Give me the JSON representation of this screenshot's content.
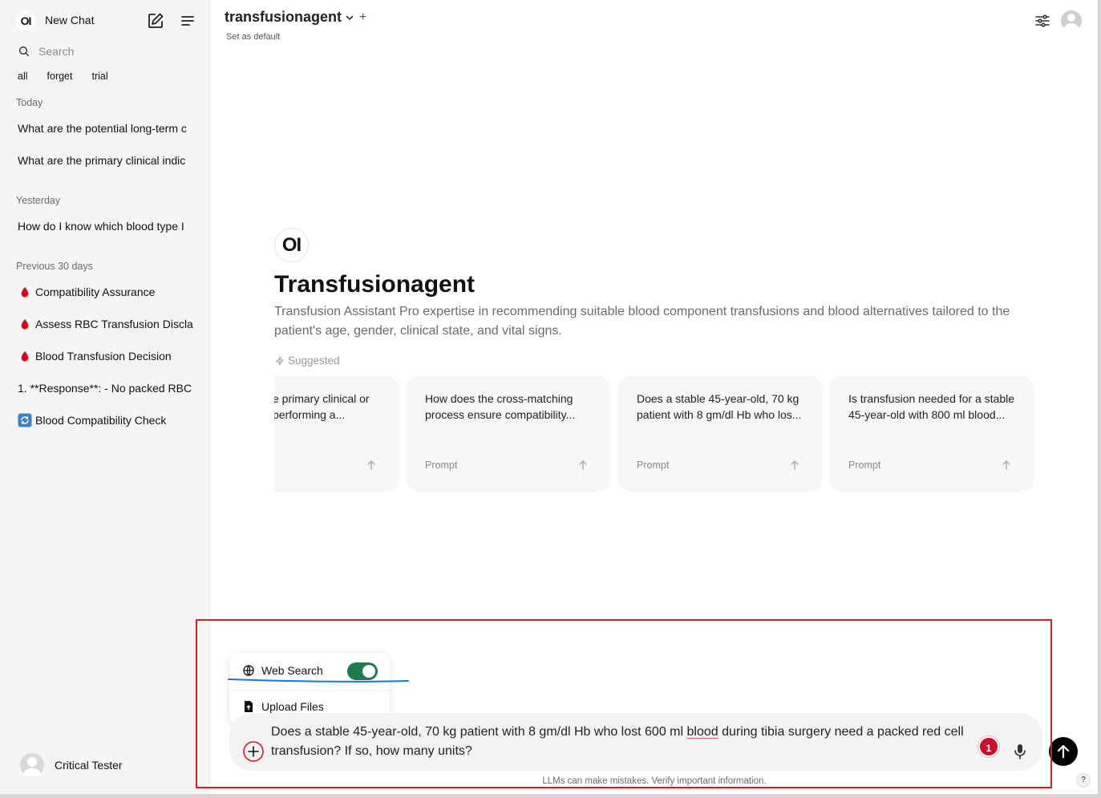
{
  "sidebar": {
    "logo_text": "OI",
    "new_chat_label": "New Chat",
    "search_placeholder": "Search",
    "tags": [
      "all",
      "forget",
      "trial"
    ],
    "sections": {
      "today": "Today",
      "yesterday": "Yesterday",
      "previous": "Previous 30 days"
    },
    "today_items": [
      "What are the potential long-term c",
      "What are the primary clinical indic"
    ],
    "yesterday_items": [
      "How do I know which blood type I"
    ],
    "previous_items": [
      {
        "label": "Compatibility Assurance",
        "icon": "blood-drop-icon"
      },
      {
        "label": "Assess RBC Transfusion Discla",
        "icon": "blood-drop-icon"
      },
      {
        "label": "Blood Transfusion Decision",
        "icon": "blood-drop-icon"
      },
      {
        "label": "1. **Response**: - No packed RBC",
        "icon": ""
      },
      {
        "label": "Blood Compatibility Check",
        "icon": "refresh-icon"
      }
    ],
    "user_name": "Critical Tester"
  },
  "header": {
    "model_name": "transfusionagent",
    "set_default": "Set as default"
  },
  "hero": {
    "logo_text": "OI",
    "title": "Transfusionagent",
    "description": "Transfusion Assistant Pro expertise in recommending suitable blood component transfusions and blood alternatives tailored to the patient's age, gender, clinical state, and vital signs.",
    "suggested_label": "Suggested"
  },
  "suggestions": [
    {
      "text": "e primary clinical or performing a...",
      "label": ""
    },
    {
      "text": "How does the cross-matching process ensure compatibility...",
      "label": "Prompt"
    },
    {
      "text": "Does a stable 45-year-old, 70 kg patient with 8 gm/dl Hb who los...",
      "label": "Prompt"
    },
    {
      "text": "Is transfusion needed for a stable 45-year-old with 800 ml blood...",
      "label": "Prompt"
    }
  ],
  "popup": {
    "web_search_label": "Web Search",
    "web_search_enabled": true,
    "upload_label": "Upload Files"
  },
  "input": {
    "text_before": "Does a stable 45-year-old, 70 kg patient with 8 gm/dl Hb who lost 600 ml ",
    "text_underlined": "blood",
    "text_after": " during tibia surgery need a packed red cell transfusion? If so, how many units?",
    "grammar_count": "1"
  },
  "disclaimer": "LLMs can make mistakes. Verify important information.",
  "help_label": "?",
  "colors": {
    "accent_green": "#1f7a4d",
    "annotation_red": "#e0191e",
    "annotation_blue": "#1a73e8",
    "blood_red": "#c8102e"
  }
}
